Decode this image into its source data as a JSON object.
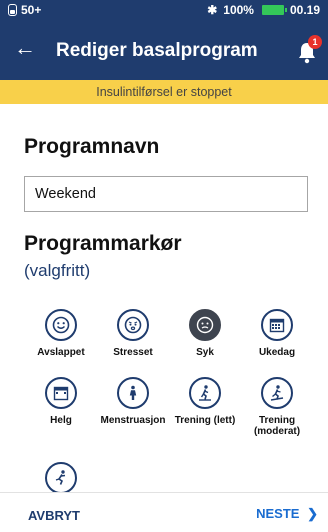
{
  "status_bar": {
    "signal": "50+",
    "battery_percent": "100%",
    "time": "00.19"
  },
  "app_bar": {
    "title": "Rediger basalprogram",
    "notification_count": "1"
  },
  "banner": {
    "text": "Insulintilførsel er stoppet"
  },
  "program_name": {
    "label": "Programnavn",
    "value": "Weekend"
  },
  "program_marker": {
    "label": "Programmarkør",
    "optional": "(valgfritt)",
    "items": [
      {
        "label": "Avslappet",
        "icon": "relaxed-face-icon",
        "selected": false
      },
      {
        "label": "Stresset",
        "icon": "stressed-face-icon",
        "selected": false
      },
      {
        "label": "Syk",
        "icon": "sick-face-icon",
        "selected": true
      },
      {
        "label": "Ukedag",
        "icon": "calendar-week-icon",
        "selected": false
      },
      {
        "label": "Helg",
        "icon": "calendar-weekend-icon",
        "selected": false
      },
      {
        "label": "Menstruasjon",
        "icon": "menstruation-icon",
        "selected": false
      },
      {
        "label": "Trening (lett)",
        "icon": "exercise-light-icon",
        "selected": false
      },
      {
        "label": "Trening (moderat)",
        "icon": "exercise-moderate-icon",
        "selected": false
      },
      {
        "label": "",
        "icon": "exercise-intense-icon",
        "selected": false
      }
    ]
  },
  "footer": {
    "cancel_label": "AVBRYT",
    "next_label": "NESTE"
  },
  "colors": {
    "header": "#1f3c6e",
    "banner": "#f8d04a",
    "accent": "#1a6cd0",
    "selected": "#3e444f"
  }
}
